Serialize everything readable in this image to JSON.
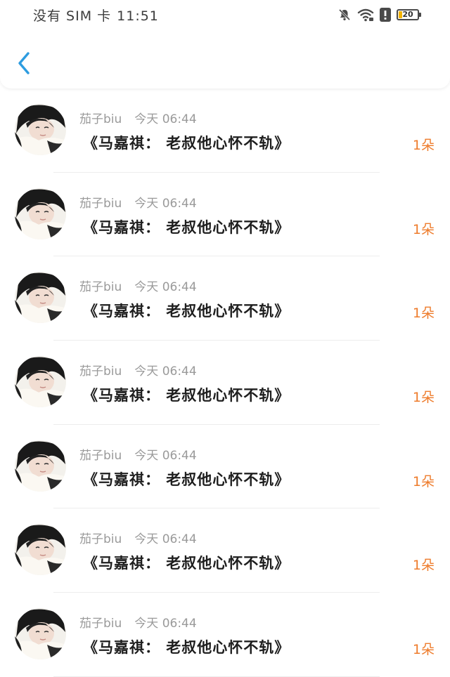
{
  "status_bar": {
    "carrier": "没有 SIM 卡",
    "time": "11:51",
    "battery_level": "20",
    "icons": [
      "bell-muted-icon",
      "wifi-icon",
      "alert-icon",
      "battery-icon"
    ]
  },
  "header": {
    "back_icon": "chevron-left-icon"
  },
  "colors": {
    "accent": "#2d9ce0",
    "count": "#ee7c2c"
  },
  "items": [
    {
      "user": "茄子biu",
      "time": "今天 06:44",
      "title": "《马嘉祺：  老叔他心怀不轨》",
      "count": "1朵"
    },
    {
      "user": "茄子biu",
      "time": "今天 06:44",
      "title": "《马嘉祺：  老叔他心怀不轨》",
      "count": "1朵"
    },
    {
      "user": "茄子biu",
      "time": "今天 06:44",
      "title": "《马嘉祺：  老叔他心怀不轨》",
      "count": "1朵"
    },
    {
      "user": "茄子biu",
      "time": "今天 06:44",
      "title": "《马嘉祺：  老叔他心怀不轨》",
      "count": "1朵"
    },
    {
      "user": "茄子biu",
      "time": "今天 06:44",
      "title": "《马嘉祺：  老叔他心怀不轨》",
      "count": "1朵"
    },
    {
      "user": "茄子biu",
      "time": "今天 06:44",
      "title": "《马嘉祺：  老叔他心怀不轨》",
      "count": "1朵"
    },
    {
      "user": "茄子biu",
      "time": "今天 06:44",
      "title": "《马嘉祺：  老叔他心怀不轨》",
      "count": "1朵"
    }
  ]
}
